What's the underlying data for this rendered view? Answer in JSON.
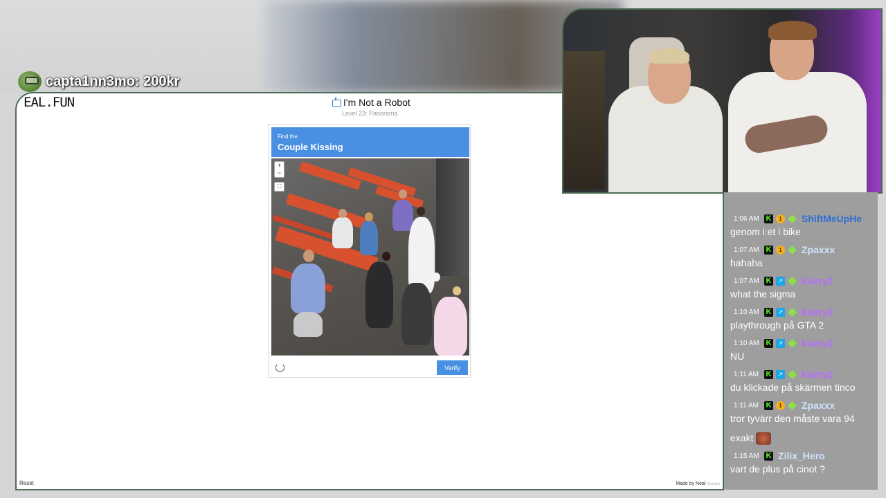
{
  "donation": {
    "text": "capta1nn3mo: 200kr",
    "icon": "pepe-avatar-icon"
  },
  "site": {
    "brand": "EAL.FUN",
    "title": "I'm Not a Robot",
    "level": "Level 23: Panorama",
    "reset_label": "Reset",
    "made_by": "Made by Neal",
    "made_by_tag": "(human)"
  },
  "captcha": {
    "find_label": "Find the",
    "target": "Couple Kissing",
    "zoom_in": "+",
    "zoom_out": "−",
    "fullscreen": "⛶",
    "verify_label": "Verify",
    "accent": "#4a90e2"
  },
  "chat": {
    "messages": [
      {
        "time": "1:06 AM",
        "badges": [
          "k",
          "coin",
          "gem"
        ],
        "user": "ShiftMeUpHe",
        "user_color": "#2f6fd6",
        "text": "genom i:et i bike"
      },
      {
        "time": "1:07 AM",
        "badges": [
          "k",
          "coin",
          "gem"
        ],
        "user": "Zpaxxx",
        "user_color": "#cfe3ff",
        "text": "hahaha"
      },
      {
        "time": "1:07 AM",
        "badges": [
          "k",
          "bolt",
          "gem"
        ],
        "user": "klarry2",
        "user_color": "#b86bff",
        "text": "what the sigma"
      },
      {
        "time": "1:10 AM",
        "badges": [
          "k",
          "bolt",
          "gem"
        ],
        "user": "klarry2",
        "user_color": "#b86bff",
        "text": "playthrough på GTA 2"
      },
      {
        "time": "1:10 AM",
        "badges": [
          "k",
          "bolt",
          "gem"
        ],
        "user": "klarry2",
        "user_color": "#b86bff",
        "text": "NU"
      },
      {
        "time": "1:11 AM",
        "badges": [
          "k",
          "bolt",
          "gem"
        ],
        "user": "klarry2",
        "user_color": "#b86bff",
        "text": "du klickade på skärmen tinco"
      },
      {
        "time": "1:11 AM",
        "badges": [
          "k",
          "coin",
          "gem"
        ],
        "user": "Zpaxxx",
        "user_color": "#cfe3ff",
        "text": "tror tyvärr den måste vara 94"
      },
      {
        "time": "",
        "badges": [],
        "user": "",
        "user_color": "#ffffff",
        "text": "exakt"
      },
      {
        "time": "1:15 AM",
        "badges": [
          "k"
        ],
        "user": "Zilix_Hero",
        "user_color": "#cfe3ff",
        "text": "vart de plus på cinot ?"
      }
    ],
    "badge_k": "K",
    "badge_coin": "1",
    "badge_bolt": "↗"
  }
}
